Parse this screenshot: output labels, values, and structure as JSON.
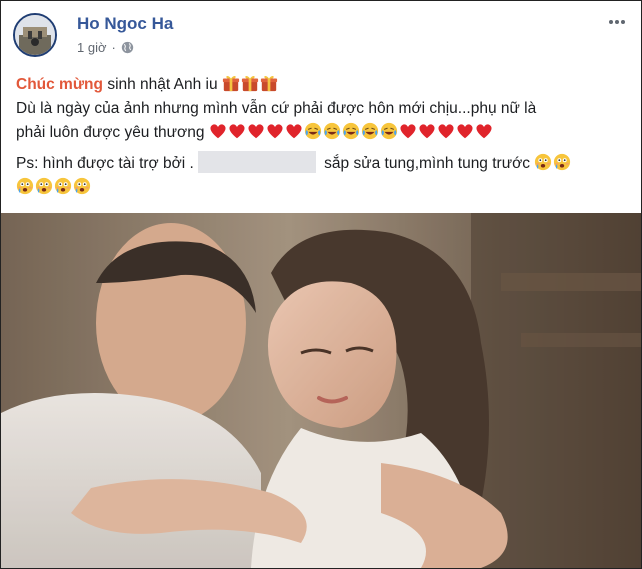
{
  "post": {
    "author": "Ho Ngoc Ha",
    "time": "1 giờ",
    "separator": "·",
    "audience_icon": "globe-icon",
    "more_icon": "more-options-icon",
    "line1": {
      "highlight": "Chúc mừng",
      "rest": "sinh nhật Anh iu"
    },
    "line2": {
      "part1": "Dù là ngày của ảnh nhưng mình vẫn cứ phải được hôn mới chịu...phụ nữ là",
      "part2": "phải luôn được yêu thương"
    },
    "line3": {
      "before": "Ps: hình được tài trợ bởi .",
      "after": "sắp sửa tung,mình tung trước"
    },
    "emoji": [
      "gift-icon",
      "heart-icon",
      "tears-of-joy-icon",
      "flushed-face-icon"
    ],
    "colors": {
      "author": "#365899",
      "highlight": "#e2583a",
      "heart": "#e0242b"
    }
  },
  "photo": {
    "alt": ""
  }
}
